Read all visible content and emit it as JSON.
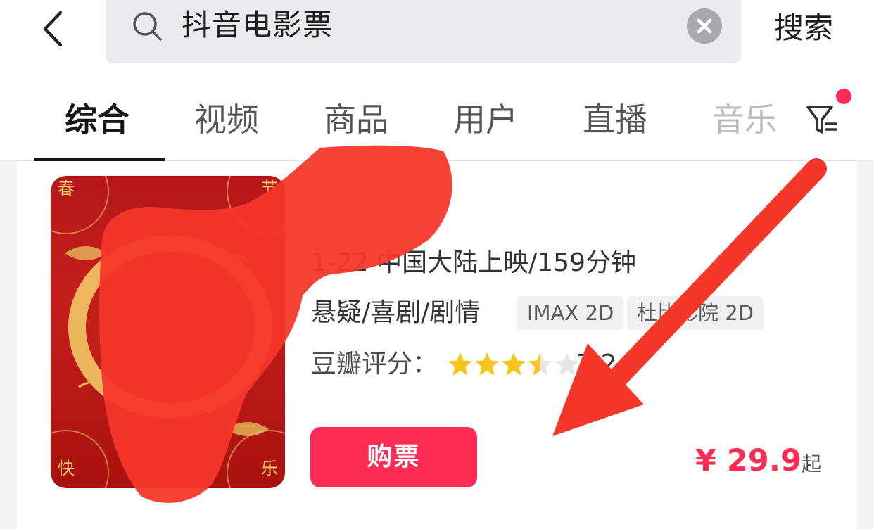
{
  "search": {
    "query": "抖音电影票",
    "submit_label": "搜索"
  },
  "tabs": [
    {
      "label": "综合",
      "active": true
    },
    {
      "label": "视频",
      "active": false
    },
    {
      "label": "商品",
      "active": false
    },
    {
      "label": "用户",
      "active": false
    },
    {
      "label": "直播",
      "active": false
    },
    {
      "label": "音乐",
      "active": false
    }
  ],
  "icons": {
    "back": "back-chevron-icon",
    "search": "search-icon",
    "clear": "clear-icon",
    "filter": "filter-icon",
    "star": "star-icon"
  },
  "movie": {
    "release_info": "1-22 中国大陆上映/159分钟",
    "genres": "悬疑/喜剧/剧情",
    "formats": [
      "IMAX 2D",
      "杜比影院 2D"
    ],
    "rating_label": "豆瓣评分：",
    "rating_value": "7.2",
    "stars_out_of_five": 3.5,
    "poster_corners": [
      "春",
      "节",
      "快",
      "乐"
    ],
    "buy_label": "购票",
    "price": "¥ 29.9",
    "price_suffix": "起"
  },
  "colors": {
    "accent": "#fe2c55",
    "annotation_red": "#f5372a",
    "star": "#f8c61b",
    "star_empty": "#e6e6e6"
  }
}
